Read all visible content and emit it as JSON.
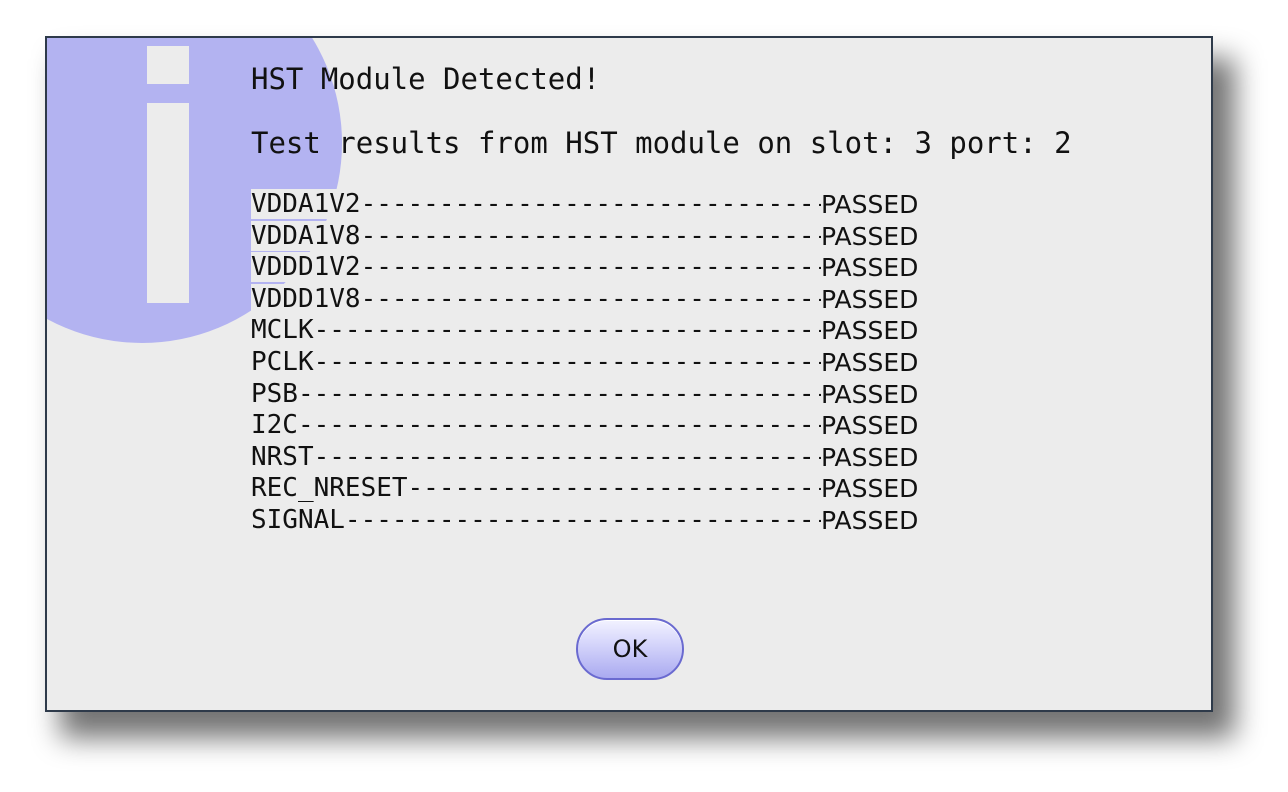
{
  "dialog": {
    "title": "HST Module Detected!",
    "message": "Test results from HST module on slot: 3 port: 2",
    "results": [
      {
        "name": "VDDA1V2",
        "status": "PASSED"
      },
      {
        "name": "VDDA1V8",
        "status": "PASSED"
      },
      {
        "name": "VDDD1V2",
        "status": "PASSED"
      },
      {
        "name": "VDDD1V8",
        "status": "PASSED"
      },
      {
        "name": "MCLK",
        "status": "PASSED"
      },
      {
        "name": "PCLK",
        "status": "PASSED"
      },
      {
        "name": "PSB",
        "status": "PASSED"
      },
      {
        "name": "I2C",
        "status": "PASSED"
      },
      {
        "name": "NRST",
        "status": "PASSED"
      },
      {
        "name": "REC_NRESET",
        "status": "PASSED"
      },
      {
        "name": "SIGNAL",
        "status": "PASSED"
      }
    ],
    "ok_label": "OK",
    "icon": "info-icon",
    "colors": {
      "icon_circle": "#b3b3f1",
      "icon_glyph": "#ececec",
      "background": "#ececec",
      "border": "#2e3a4a"
    }
  }
}
